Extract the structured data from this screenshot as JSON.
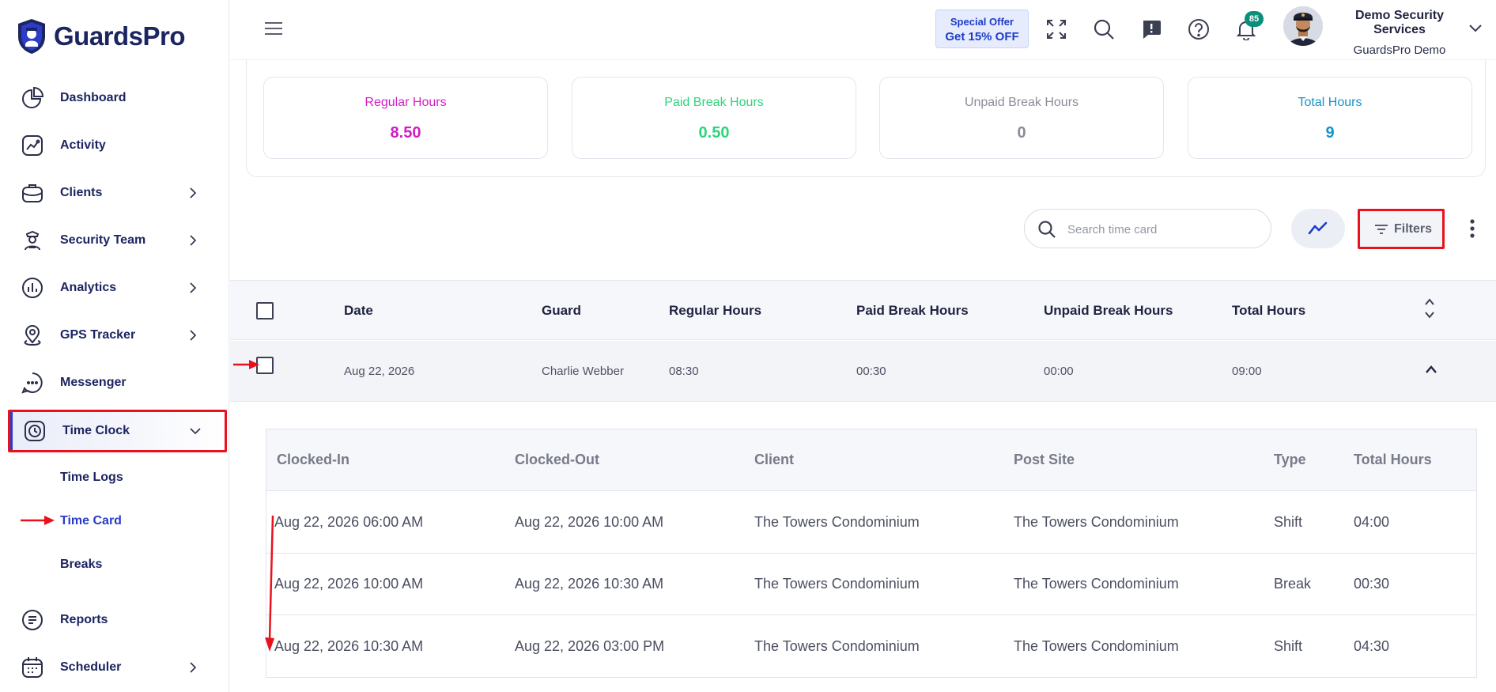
{
  "brand": {
    "name": "GuardsPro"
  },
  "sidebar": {
    "items": [
      {
        "label": "Dashboard"
      },
      {
        "label": "Activity"
      },
      {
        "label": "Clients"
      },
      {
        "label": "Security Team"
      },
      {
        "label": "Analytics"
      },
      {
        "label": "GPS Tracker"
      },
      {
        "label": "Messenger"
      },
      {
        "label": "Time Clock"
      },
      {
        "label": "Reports"
      },
      {
        "label": "Scheduler"
      }
    ],
    "time_clock_sub": [
      {
        "label": "Time Logs"
      },
      {
        "label": "Time Card"
      },
      {
        "label": "Breaks"
      }
    ]
  },
  "header": {
    "offer_line1": "Special Offer",
    "offer_line2": "Get 15% OFF",
    "notification_count": "85",
    "company_name": "Demo Security Services",
    "account_name": "GuardsPro Demo"
  },
  "summary": {
    "regular": {
      "label": "Regular Hours",
      "value": "8.50",
      "color": "#d21cc4"
    },
    "paid_break": {
      "label": "Paid Break Hours",
      "value": "0.50",
      "color": "#2fd47b"
    },
    "unpaid_break": {
      "label": "Unpaid Break Hours",
      "value": "0",
      "color": "#8a8d99"
    },
    "total": {
      "label": "Total Hours",
      "value": "9",
      "color": "#1594c9"
    }
  },
  "toolbar": {
    "search_placeholder": "Search time card",
    "filters_label": "Filters"
  },
  "table": {
    "headers": {
      "date": "Date",
      "guard": "Guard",
      "regular": "Regular Hours",
      "paid_break": "Paid Break Hours",
      "unpaid_break": "Unpaid Break Hours",
      "total": "Total Hours"
    },
    "row": {
      "date": "Aug 22, 2026",
      "guard": "Charlie Webber",
      "regular": "08:30",
      "paid_break": "00:30",
      "unpaid_break": "00:00",
      "total": "09:00"
    }
  },
  "detail": {
    "headers": {
      "clocked_in": "Clocked-In",
      "clocked_out": "Clocked-Out",
      "client": "Client",
      "post_site": "Post Site",
      "type": "Type",
      "total": "Total Hours"
    },
    "rows": [
      {
        "clocked_in": "Aug 22, 2026 06:00 AM",
        "clocked_out": "Aug 22, 2026 10:00 AM",
        "client": "The Towers Condominium",
        "post_site": "The Towers Condominium",
        "type": "Shift",
        "total": "04:00"
      },
      {
        "clocked_in": "Aug 22, 2026 10:00 AM",
        "clocked_out": "Aug 22, 2026 10:30 AM",
        "client": "The Towers Condominium",
        "post_site": "The Towers Condominium",
        "type": "Break",
        "total": "00:30"
      },
      {
        "clocked_in": "Aug 22, 2026 10:30 AM",
        "clocked_out": "Aug 22, 2026 03:00 PM",
        "client": "The Towers Condominium",
        "post_site": "The Towers Condominium",
        "type": "Shift",
        "total": "04:30"
      }
    ]
  },
  "colors": {
    "brand_navy": "#1c2561",
    "accent_blue": "#2a3cc8",
    "highlight_red": "#e8111c"
  }
}
